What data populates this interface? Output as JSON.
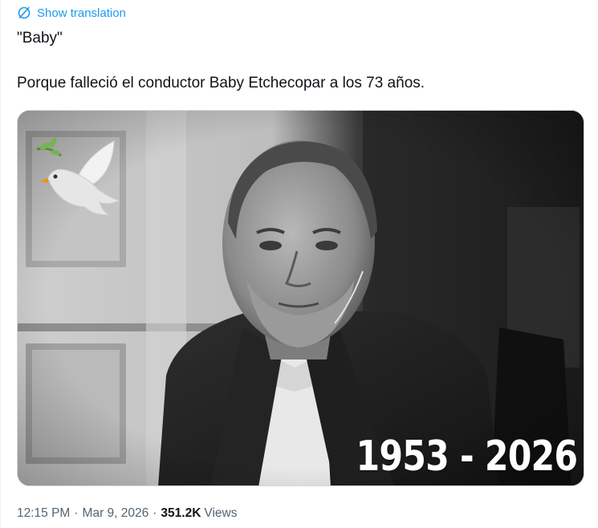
{
  "translation": {
    "label": "Show translation",
    "icon": "globe-slash-icon",
    "color": "#1d9bf0"
  },
  "tweet": {
    "line1": "\"Baby\"",
    "line2": "Porque falleció el conductor Baby Etchecopar a los 73 años."
  },
  "media": {
    "years_text": "1953 - 2026",
    "dove_icon": "dove-emoji-icon",
    "style": "black-and-white portrait photo"
  },
  "meta": {
    "time": "12:15 PM",
    "separator1": "·",
    "date": "Mar 9, 2026",
    "separator2": "·",
    "views_count": "351.2K",
    "views_label": "Views"
  }
}
